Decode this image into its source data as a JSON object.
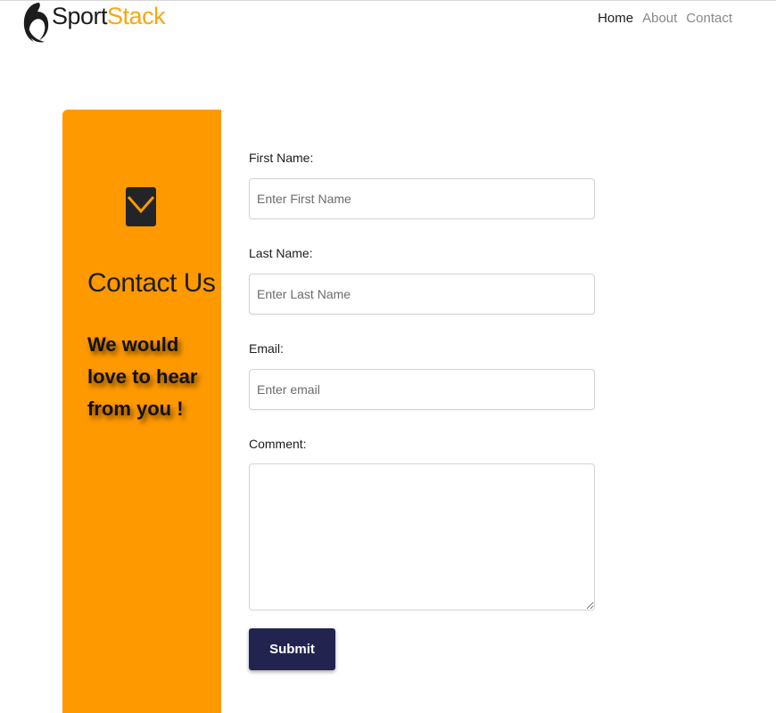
{
  "brand": {
    "part1": "Sport",
    "part2": "Stack",
    "accent_color": "#f7a711"
  },
  "nav": {
    "items": [
      {
        "label": "Home",
        "active": true
      },
      {
        "label": "About",
        "active": false
      },
      {
        "label": "Contact",
        "active": false
      }
    ]
  },
  "panel": {
    "background": "#ff9900",
    "icon": "envelope-icon",
    "title": "Contact Us",
    "subtitle": "We would love to hear from you !"
  },
  "form": {
    "first_name": {
      "label": "First Name:",
      "placeholder": "Enter First Name",
      "value": ""
    },
    "last_name": {
      "label": "Last Name:",
      "placeholder": "Enter Last Name",
      "value": ""
    },
    "email": {
      "label": "Email:",
      "placeholder": "Enter email",
      "value": ""
    },
    "comment": {
      "label": "Comment:",
      "value": ""
    },
    "submit_label": "Submit",
    "submit_color": "#22244f"
  }
}
